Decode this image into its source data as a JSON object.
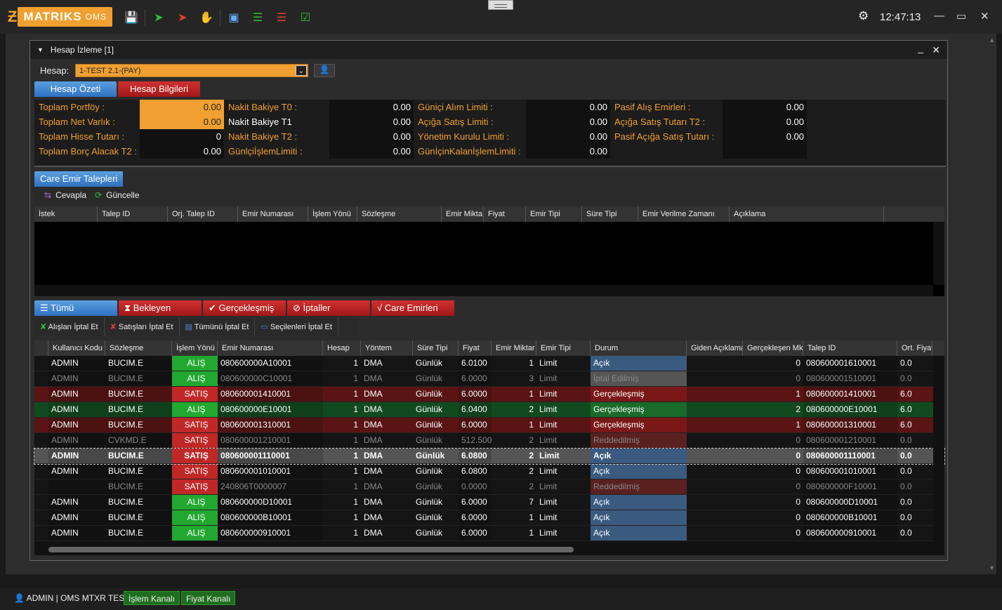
{
  "app": {
    "logo": "MATRIKS",
    "logo_sub": "OMS",
    "time": "12:47:13"
  },
  "panel": {
    "title": "Hesap İzleme [1]"
  },
  "hesap": {
    "label": "Hesap:",
    "value": "1-TEST 2.1-(PAY)"
  },
  "tabs": [
    "Hesap Özeti",
    "Hesap Bilgileri"
  ],
  "summary": [
    [
      {
        "l": "Toplam Portföy :",
        "v": "0.00"
      },
      {
        "l": "Nakit Bakiye T0 :",
        "v": "0.00"
      },
      {
        "l": "Güniçi Alım Limiti :",
        "v": "0.00"
      },
      {
        "l": "Pasif Alış Emirleri :",
        "v": "0.00"
      }
    ],
    [
      {
        "l": "Toplam Net Varlık :",
        "v": "0.00"
      },
      {
        "l": "Nakit Bakiye T1",
        "v": "0.00"
      },
      {
        "l": "Açığa Satış Limiti :",
        "v": "0.00"
      },
      {
        "l": "Açığa Satış Tutarı T2 :",
        "v": "0.00"
      }
    ],
    [
      {
        "l": "Toplam Hisse Tutarı :",
        "v": "0"
      },
      {
        "l": "Nakit Bakiye T2 :",
        "v": "0.00"
      },
      {
        "l": "Yönetim Kurulu Limiti :",
        "v": "0.00"
      },
      {
        "l": "Pasif Açığa Satış Tutarı :",
        "v": "0.00"
      }
    ],
    [
      {
        "l": "Toplam Borç Alacak T2 :",
        "v": "0.00"
      },
      {
        "l": "GünlçiİşlemLimiti :",
        "v": "0.00"
      },
      {
        "l": "GünİçinKalanİşlemLimiti :",
        "v": "0.00"
      },
      {
        "l": "",
        "v": ""
      }
    ]
  ],
  "care": {
    "tab": "Care Emir Talepleri",
    "reply": "Cevapla",
    "refresh": "Güncelle",
    "columns": [
      "İstek",
      "Talep ID",
      "Orj. Talep ID",
      "Emir Numarası",
      "İşlem Yönü",
      "Sözleşme",
      "Emir Mikta",
      "Fiyat",
      "Emir Tipi",
      "Süre Tipi",
      "Emir Verilme Zamanı",
      "Açıklama"
    ]
  },
  "order_tabs": [
    "Tümü",
    "Bekleyen",
    "Gerçekleşmiş",
    "İptaller",
    "Care Emirleri"
  ],
  "actions": [
    "Alışları İptal Et",
    "Satışları İptal Et",
    "Tümünü İptal Et",
    "Seçilenleri İptal Et"
  ],
  "order_columns": [
    "Kullanıcı Kodu",
    "Sözleşme",
    "İşlem Yönü",
    "Emir Numarası",
    "Hesap",
    "Yöntem",
    "Süre Tipi",
    "Fiyat",
    "Emir Miktar",
    "Emir Tipi",
    "Durum",
    "Giden Açıklama",
    "Gerçekleşen Mk",
    "Talep ID",
    "Ort. Fiyat"
  ],
  "orders": [
    {
      "user": "ADMIN",
      "sym": "BUCIM.E",
      "side": "ALIŞ",
      "no": "080600000A10001",
      "acc": "1",
      "method": "DMA",
      "dur": "Günlük",
      "price": "6.0100",
      "qty": "1",
      "type": "Limit",
      "status": "Açık",
      "filled": "0",
      "req": "080600001610001",
      "avg": "0.0",
      "kind": "open"
    },
    {
      "user": "ADMIN",
      "sym": "BUCIM.E",
      "side": "ALIŞ",
      "no": "080600000C10001",
      "acc": "1",
      "method": "DMA",
      "dur": "Günlük",
      "price": "6.0000",
      "qty": "3",
      "type": "Limit",
      "status": "İptal Edilmiş",
      "filled": "0",
      "req": "080600001510001",
      "avg": "0.0",
      "kind": "cancel"
    },
    {
      "user": "ADMIN",
      "sym": "BUCIM.E",
      "side": "SATIŞ",
      "no": "080600001410001",
      "acc": "1",
      "method": "DMA",
      "dur": "Günlük",
      "price": "6.0000",
      "qty": "1",
      "type": "Limit",
      "status": "Gerçekleşmiş",
      "filled": "1",
      "req": "080600001410001",
      "avg": "6.0",
      "kind": "fill-sell"
    },
    {
      "user": "ADMIN",
      "sym": "BUCIM.E",
      "side": "ALIŞ",
      "no": "080600000E10001",
      "acc": "1",
      "method": "DMA",
      "dur": "Günlük",
      "price": "6.0400",
      "qty": "2",
      "type": "Limit",
      "status": "Gerçekleşmiş",
      "filled": "2",
      "req": "080600000E10001",
      "avg": "6.0",
      "kind": "fill-buy"
    },
    {
      "user": "ADMIN",
      "sym": "BUCIM.E",
      "side": "SATIŞ",
      "no": "080600001310001",
      "acc": "1",
      "method": "DMA",
      "dur": "Günlük",
      "price": "6.0000",
      "qty": "1",
      "type": "Limit",
      "status": "Gerçekleşmiş",
      "filled": "1",
      "req": "080600001310001",
      "avg": "6.0",
      "kind": "fill-sell"
    },
    {
      "user": "ADMIN",
      "sym": "CVKMD.E",
      "side": "SATIŞ",
      "no": "080600001210001",
      "acc": "1",
      "method": "DMA",
      "dur": "Günlük",
      "price": "512.500",
      "qty": "2",
      "type": "Limit",
      "status": "Reddedilmiş",
      "filled": "0",
      "req": "080600001210001",
      "avg": "0.0",
      "kind": "reject"
    },
    {
      "user": "ADMIN",
      "sym": "BUCIM.E",
      "side": "SATIŞ",
      "no": "080600001110001",
      "acc": "1",
      "method": "DMA",
      "dur": "Günlük",
      "price": "6.0800",
      "qty": "2",
      "type": "Limit",
      "status": "Açık",
      "filled": "0",
      "req": "080600001110001",
      "avg": "0.0",
      "kind": "selected"
    },
    {
      "user": "ADMIN",
      "sym": "BUCIM.E",
      "side": "SATIŞ",
      "no": "080600001010001",
      "acc": "1",
      "method": "DMA",
      "dur": "Günlük",
      "price": "6.0800",
      "qty": "2",
      "type": "Limit",
      "status": "Açık",
      "filled": "0",
      "req": "080600001010001",
      "avg": "0.0",
      "kind": "open"
    },
    {
      "user": "",
      "sym": "BUCIM.E",
      "side": "SATIŞ",
      "no": "240806T0000007",
      "acc": "1",
      "method": "DMA",
      "dur": "Günlük",
      "price": "0.0000",
      "qty": "2",
      "type": "Limit",
      "status": "Reddedilmiş",
      "filled": "0",
      "req": "080600000F10001",
      "avg": "0.0",
      "kind": "reject"
    },
    {
      "user": "ADMIN",
      "sym": "BUCIM.E",
      "side": "ALIŞ",
      "no": "080600000D10001",
      "acc": "1",
      "method": "DMA",
      "dur": "Günlük",
      "price": "6.0000",
      "qty": "7",
      "type": "Limit",
      "status": "Açık",
      "filled": "0",
      "req": "080600000D10001",
      "avg": "0.0",
      "kind": "open"
    },
    {
      "user": "ADMIN",
      "sym": "BUCIM.E",
      "side": "ALIŞ",
      "no": "080600000B10001",
      "acc": "1",
      "method": "DMA",
      "dur": "Günlük",
      "price": "6.0000",
      "qty": "1",
      "type": "Limit",
      "status": "Açık",
      "filled": "0",
      "req": "080600000B10001",
      "avg": "0.0",
      "kind": "open"
    },
    {
      "user": "ADMIN",
      "sym": "BUCIM.E",
      "side": "ALIŞ",
      "no": "080600000910001",
      "acc": "1",
      "method": "DMA",
      "dur": "Günlük",
      "price": "6.0000",
      "qty": "1",
      "type": "Limit",
      "status": "Açık",
      "filled": "0",
      "req": "080600000910001",
      "avg": "0.0",
      "kind": "open"
    }
  ],
  "status": {
    "user": "ADMIN | OMS MTXR TEST",
    "ch1": "İşlem Kanalı",
    "ch2": "Fiyat Kanalı"
  },
  "colors": {
    "accent": "#f0a030",
    "buy": "#22a830",
    "sell": "#c02828",
    "open": "#3a5a80"
  }
}
